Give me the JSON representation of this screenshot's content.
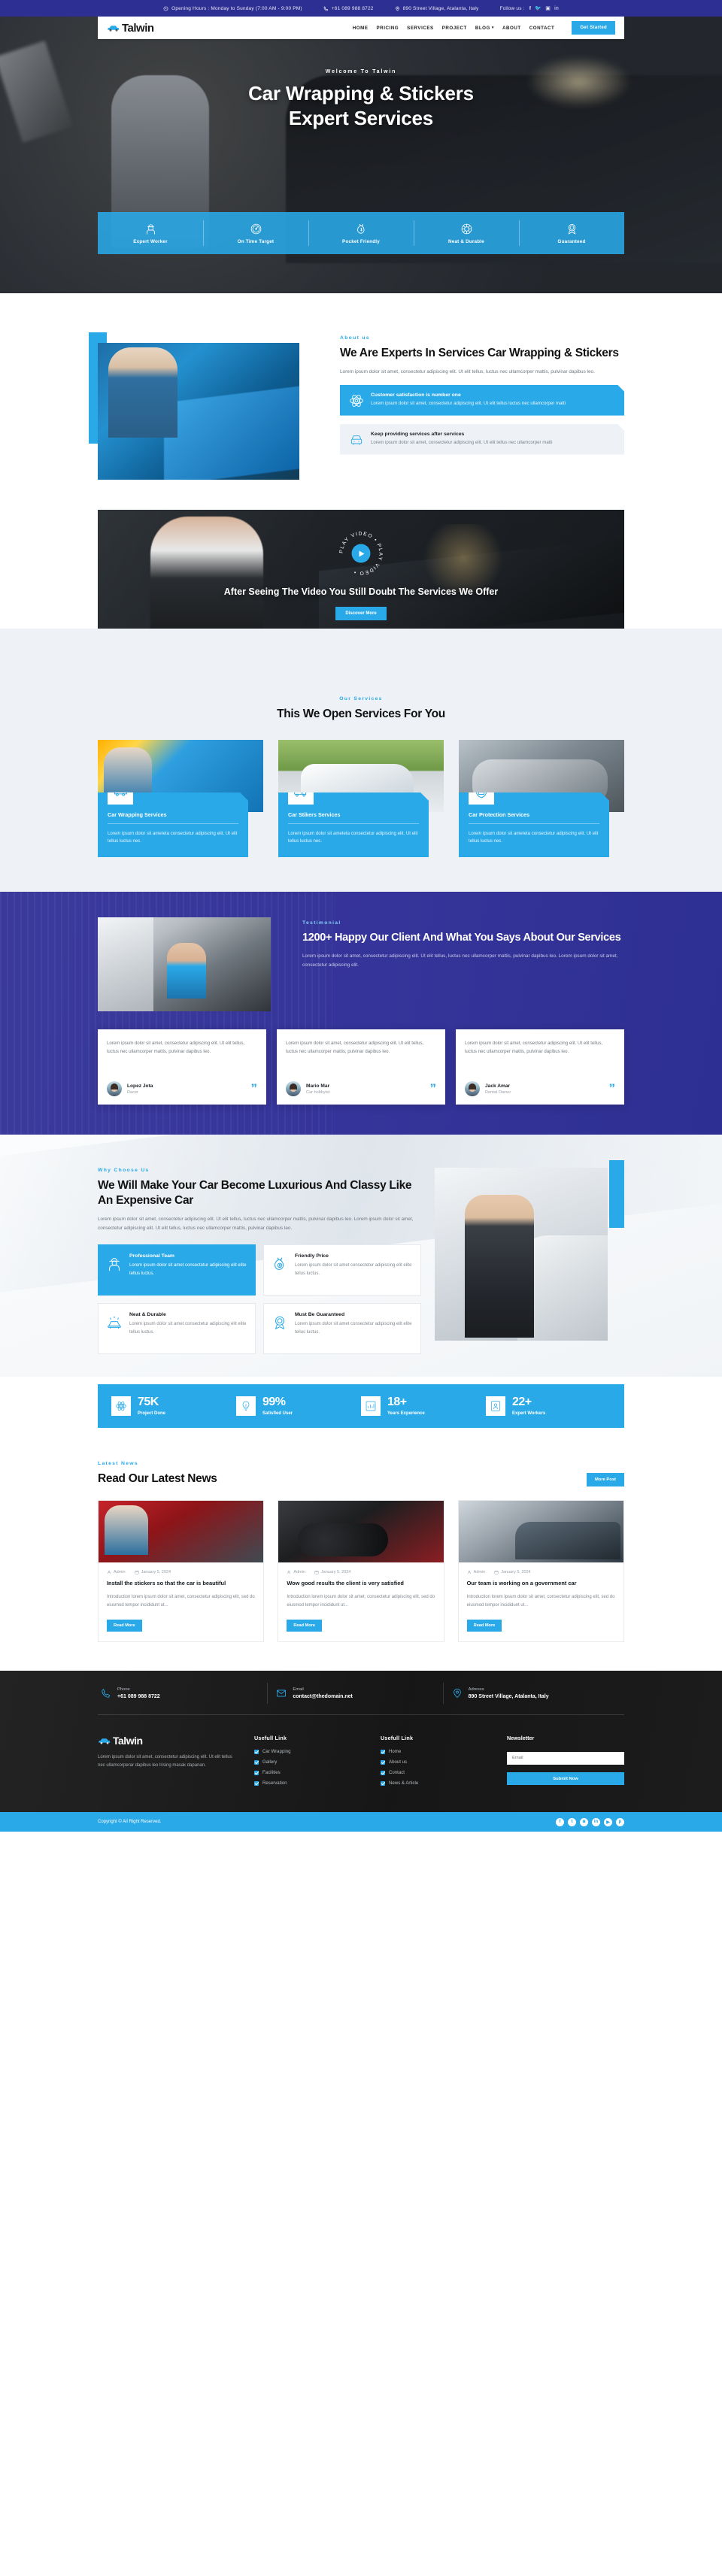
{
  "brand": {
    "name": "Talwin",
    "accent": "#29a9e8",
    "dark": "#2e2f92"
  },
  "topbar": {
    "hours": "Opening Hours : Monday to Sunday (7:00 AM - 9:00 PM)",
    "phone": "+61 089 988 8722",
    "address": "890 Street Village, Atalanta, Italy",
    "follow_label": "Follow us :",
    "socials": [
      "f",
      "t",
      "ig",
      "in"
    ]
  },
  "nav": {
    "items": [
      {
        "label": "HOME",
        "has_caret": false
      },
      {
        "label": "PRICING",
        "has_caret": false
      },
      {
        "label": "SERVICES",
        "has_caret": false
      },
      {
        "label": "PROJECT",
        "has_caret": false
      },
      {
        "label": "BLOG",
        "has_caret": true
      },
      {
        "label": "ABOUT",
        "has_caret": false
      },
      {
        "label": "CONTACT",
        "has_caret": false
      }
    ],
    "cta": "Get Started"
  },
  "hero": {
    "subtitle": "Welcome to Talwin",
    "title_line1": "Car Wrapping & Stickers",
    "title_line2": "Expert Services",
    "features": [
      {
        "label": "Expert Worker",
        "icon": "worker-icon"
      },
      {
        "label": "On Time Target",
        "icon": "speedometer-icon"
      },
      {
        "label": "Pocket Friendly",
        "icon": "money-bag-icon"
      },
      {
        "label": "Neat & Durable",
        "icon": "wheel-icon"
      },
      {
        "label": "Guaranteed",
        "icon": "badge-icon"
      }
    ]
  },
  "about": {
    "eyebrow": "About us",
    "title": "We Are Experts In Services Car Wrapping & Stickers",
    "paragraph": "Lorem ipsum dolor sit amet, consectetur adipiscing elit. Ut elit tellus, luctus nec ullamcorper mattis, pulvinar dapibus leo.",
    "cards": [
      {
        "title": "Customer satisfaction is number one",
        "desc": "Lorem ipsum dolor sit amet, consectetur adipiscing elit. Ut elit tellus luctus nec ullamcorper matti",
        "icon": "atom-icon",
        "style": "blue"
      },
      {
        "title": "Keep providing services after services",
        "desc": "Lorem ipsum dolor sit amet, consectetur adipiscing elit. Ut elit tellus nec ullamcorper matti",
        "icon": "car-front-icon",
        "style": "grey"
      }
    ]
  },
  "video": {
    "ring_text": "PLAY VIDEO • PLAY VIDEO •",
    "title": "After Seeing The Video You Still Doubt The Services We Offer",
    "button": "Discover More"
  },
  "services": {
    "eyebrow": "Our Services",
    "title": "This We Open Services For You",
    "cards": [
      {
        "title": "Car Wrapping Services",
        "desc": "Lorem ipsum dolor sit ameteta consectetur adipiscing elit. Ut elit tellus luctus nec.",
        "icon": "car-side-icon"
      },
      {
        "title": "Car Stikers Services",
        "desc": "Lorem ipsum dolor sit ameteta consectetur adipiscing elit. Ut elit tellus luctus nec.",
        "icon": "van-icon"
      },
      {
        "title": "Car Protection Services",
        "desc": "Lorem ipsum dolor sit ameteta consectetur adipiscing elit. Ut elit tellus luctus nec.",
        "icon": "shield-car-icon"
      }
    ]
  },
  "testimonial": {
    "eyebrow": "Testimonial",
    "title": "1200+ Happy Our Client And What You Says About Our Services",
    "paragraph": "Lorem ipsum dolor sit amet, consectetur adipiscing elit. Ut elit tellus, luctus nec ullamcorper mattis, pulvinar dapibus leo. Lorem ipsum dolor sit amet, consectetur adipiscing elit.",
    "cards": [
      {
        "quote": "Lorem ipsum dolor sit amet, consectetur adipiscing elit. Ut elit tellus, luctus nec ullamcorper mattis, pulvinar dapibus leo.",
        "name": "Lopez Jota",
        "role": "Racer"
      },
      {
        "quote": "Lorem ipsum dolor sit amet, consectetur adipiscing elit. Ut elit tellus, luctus nec ullamcorper mattis, pulvinar dapibus leo.",
        "name": "Mario Mar",
        "role": "Car hobbyist"
      },
      {
        "quote": "Lorem ipsum dolor sit amet, consectetur adipiscing elit. Ut elit tellus, luctus nec ullamcorper mattis, pulvinar dapibus leo.",
        "name": "Jack Amar",
        "role": "Rental Owner"
      }
    ]
  },
  "why": {
    "eyebrow": "Why Choose Us",
    "title": "We Will Make Your Car Become Luxurious And Classy Like An Expensive Car",
    "paragraph": "Lorem ipsum dolor sit amet, consectetur adipiscing elit. Ut elit tellus, luctus nec ullamcorper mattis, pulvinar dapibus leo. Lorem ipsum dolor sit amet, consectetur adipiscing elit. Ut elit tellus, luctus nec ullamcorper mattis, pulvinar dapibus leo.",
    "cards": [
      {
        "title": "Professional Team",
        "desc": "Lorem ipsum dolor sit amet consectetur adipiscing elit elite tellus luctus.",
        "icon": "worker-icon",
        "active": true
      },
      {
        "title": "Friendly Price",
        "desc": "Lorem ipsum dolor sit amet consectetur adipiscing elit elite tellus luctus.",
        "icon": "money-bag-icon",
        "active": false
      },
      {
        "title": "Neat & Durable",
        "desc": "Lorem ipsum dolor sit amet consectetur adipiscing elit elite tellus luctus.",
        "icon": "polish-icon",
        "active": false
      },
      {
        "title": "Must Be Guaranteed",
        "desc": "Lorem ipsum dolor sit amet consectetur adipiscing elit elite tellus luctus.",
        "icon": "badge-icon",
        "active": false
      }
    ]
  },
  "counters": [
    {
      "value": "75K",
      "label": "Project Done",
      "icon": "atom-icon"
    },
    {
      "value": "99%",
      "label": "Satisfied User",
      "icon": "bulb-icon"
    },
    {
      "value": "18+",
      "label": "Years Experience",
      "icon": "chart-icon"
    },
    {
      "value": "22+",
      "label": "Expert Workers",
      "icon": "worker-badge-icon"
    }
  ],
  "news": {
    "eyebrow": "Latest News",
    "title": "Read Our Latest News",
    "more_button": "More Post",
    "posts": [
      {
        "author": "Admin",
        "date": "January 5, 2024",
        "title": "Install the stickers so that the car is beautiful",
        "desc": "Introduction lorem ipsum dolor sit amet, consectetur adipiscing elit, sed do eiusmod tempor incididunt ut...",
        "button": "Read More"
      },
      {
        "author": "Admin",
        "date": "January 5, 2024",
        "title": "Wow good results the client is very satisfied",
        "desc": "Introduction lorem ipsum dolor sit amet, consectetur adipiscing elit, sed do eiusmod tempor incididunt ut...",
        "button": "Read More"
      },
      {
        "author": "Admin",
        "date": "January 5, 2024",
        "title": "Our team is working on a government car",
        "desc": "Introduction lorem ipsum dolor sit amet, consectetur adipiscing elit, sed do eiusmod tempor incididunt ut...",
        "button": "Read More"
      }
    ]
  },
  "footer": {
    "contacts": [
      {
        "label": "Phone",
        "value": "+61 089 988 8722",
        "icon": "phone-icon"
      },
      {
        "label": "Email",
        "value": "contact@thedomain.net",
        "icon": "mail-icon"
      },
      {
        "label": "Adresss",
        "value": "890 Street Village, Atalanta, Italy",
        "icon": "location-icon"
      }
    ],
    "about": "Lorem ipsum dolor sit amet, consectetur adipiscing elit. Ut elit tellus nec ullamcorperar dapibus leo lrising masak dapanan.",
    "col1": {
      "heading": "Usefull Link",
      "items": [
        "Car Wrapping",
        "Gallery",
        "Facilities",
        "Reservation"
      ]
    },
    "col2": {
      "heading": "Usefull Link",
      "items": [
        "Home",
        "About us",
        "Contact",
        "News & Article"
      ]
    },
    "newsletter": {
      "heading": "Newsletter",
      "placeholder": "Email",
      "button": "Submit Now"
    },
    "copyright": "Copyright © All Right Reserved.",
    "socials": [
      "f",
      "t",
      "ig",
      "in",
      "yt",
      "p"
    ]
  }
}
